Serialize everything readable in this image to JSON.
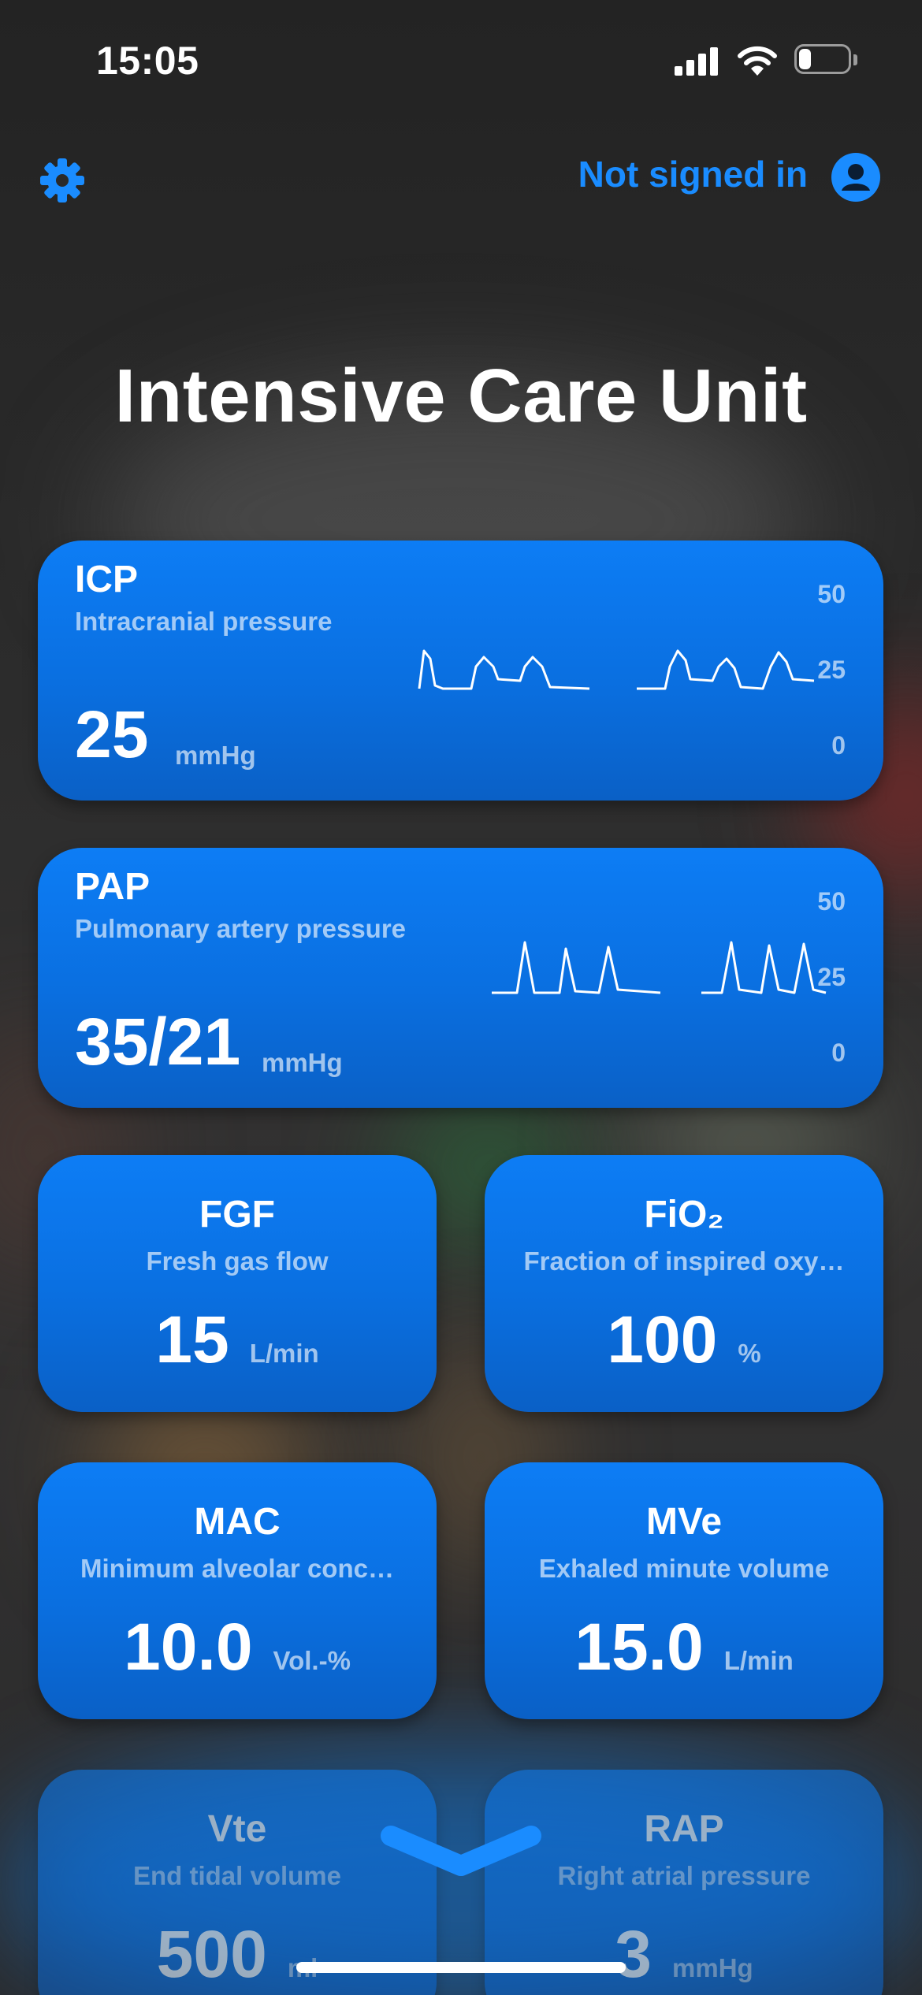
{
  "status_bar": {
    "time": "15:05",
    "signal_bars": 4,
    "battery_level": 0.25
  },
  "header": {
    "settings_icon": "gear-icon",
    "account_label": "Not signed in",
    "account_icon": "person-circle-icon"
  },
  "title": "Intensive Care Unit",
  "colors": {
    "accent": "#1a8cff",
    "card_top": "#0d7df5",
    "card_bottom": "#0a60c6",
    "background": "#2a2a2a"
  },
  "cards_wide": [
    {
      "name": "ICP",
      "desc": "Intracranial pressure",
      "value": "25",
      "unit": "mmHg",
      "axis": [
        "50",
        "25",
        "0"
      ]
    },
    {
      "name": "PAP",
      "desc": "Pulmonary artery pressure",
      "value": "35/21",
      "unit": "mmHg",
      "axis": [
        "50",
        "25",
        "0"
      ]
    }
  ],
  "cards_half": [
    {
      "name_main": "FiO",
      "name_sub": "2",
      "name": "FGF",
      "desc": "Fresh gas flow",
      "value": "15",
      "unit": "L/min"
    },
    {
      "name": "FiO₂",
      "desc": "Fraction of inspired oxy…",
      "value": "100",
      "unit": "%"
    },
    {
      "name": "MAC",
      "desc": "Minimum alveolar conc…",
      "value": "10.0",
      "unit": "Vol.-%"
    },
    {
      "name": "MVe",
      "desc": "Exhaled minute volume",
      "value": "15.0",
      "unit": "L/min"
    },
    {
      "name": "Vte",
      "desc": "End tidal volume",
      "value": "500",
      "unit": "ml"
    },
    {
      "name": "RAP",
      "desc": "Right atrial pressure",
      "value": "3",
      "unit": "mmHg"
    }
  ],
  "scroll_icon": "chevron-down-icon"
}
